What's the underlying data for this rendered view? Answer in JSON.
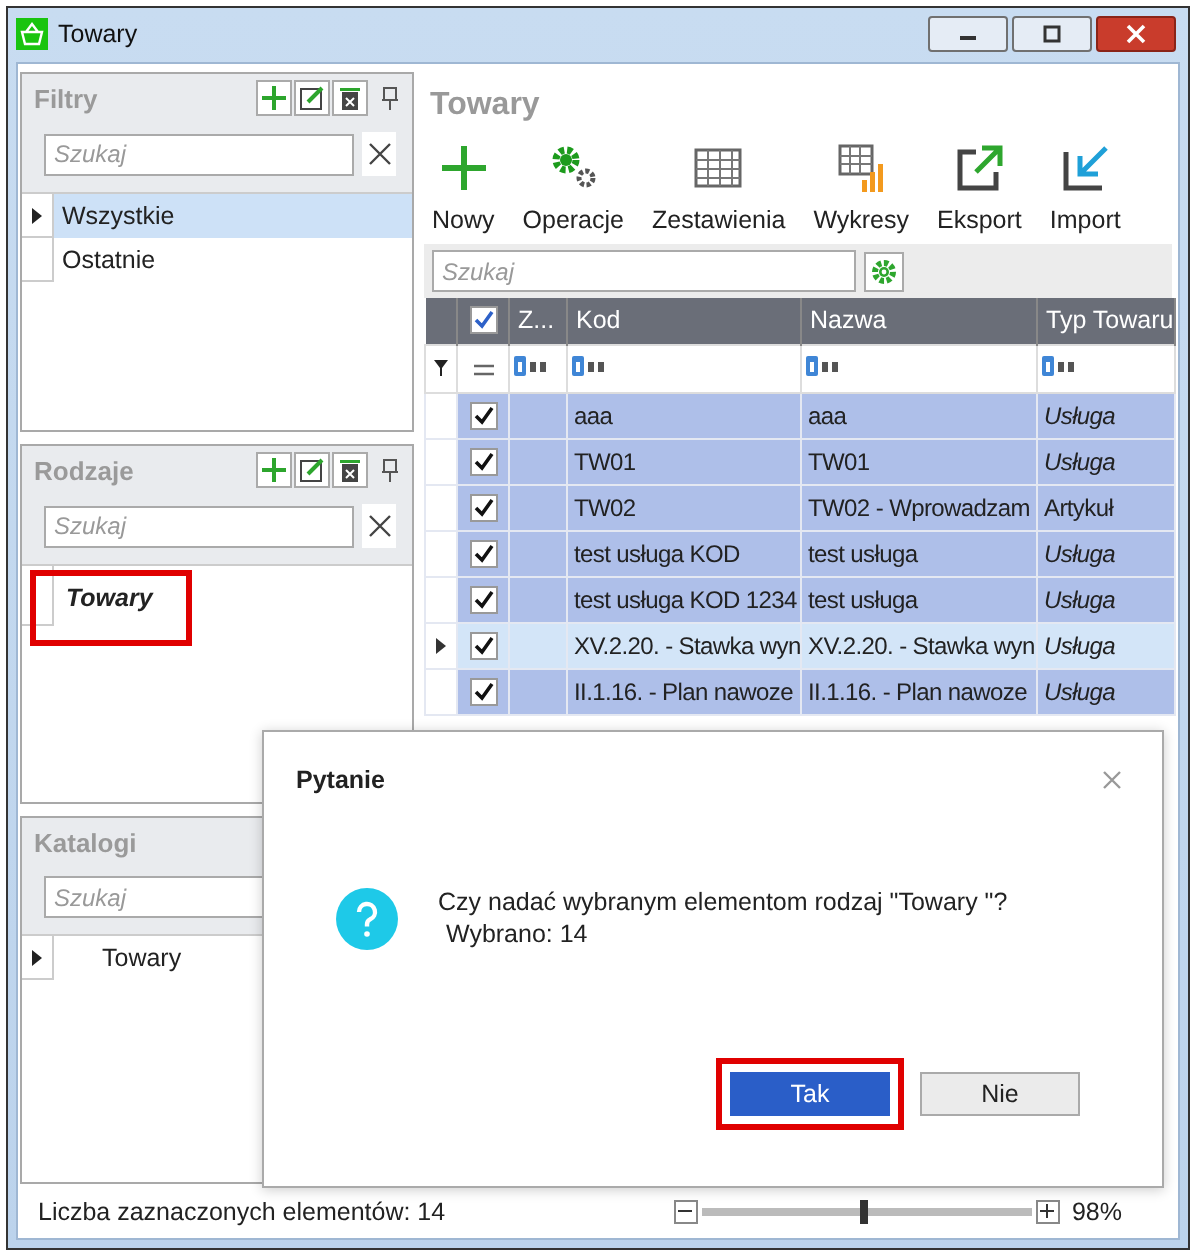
{
  "window": {
    "title": "Towary"
  },
  "panels": [
    {
      "title": "Filtry",
      "tools": true,
      "search": {
        "placeholder": "Szukaj",
        "clear_button": true
      },
      "items": [
        {
          "label": "Wszystkie",
          "selected": true,
          "expandable": true,
          "highlighted": false
        },
        {
          "label": "Ostatnie",
          "selected": false,
          "expandable": false,
          "highlighted": false
        }
      ]
    },
    {
      "title": "Rodzaje",
      "tools": true,
      "search": {
        "placeholder": "Szukaj",
        "clear_button": true
      },
      "items": [
        {
          "label": "Towary",
          "selected": false,
          "expandable": false,
          "highlighted": true
        }
      ]
    },
    {
      "title": "Katalogi",
      "tools": false,
      "search": {
        "placeholder": "Szukaj",
        "clear_button": false
      },
      "items": [
        {
          "label": "Towary",
          "selected": false,
          "expandable": true,
          "highlighted": false
        }
      ]
    }
  ],
  "heading": "Towary",
  "toolbar": [
    {
      "label": "Nowy",
      "kind": "plus"
    },
    {
      "label": "Operacje",
      "kind": "gears"
    },
    {
      "label": "Zestawienia",
      "kind": "table"
    },
    {
      "label": "Wykresy",
      "kind": "chart"
    },
    {
      "label": "Eksport",
      "kind": "export"
    },
    {
      "label": "Import",
      "kind": "import"
    }
  ],
  "grid_search": {
    "placeholder": "Szukaj"
  },
  "grid": {
    "all_checked": true,
    "columns": [
      "Z...",
      "Kod",
      "Nazwa",
      "Typ Towaru"
    ],
    "rows": [
      {
        "checked": true,
        "selected": true,
        "current": false,
        "kod": "aaa",
        "nazwa": "aaa",
        "typ": "Usługa",
        "typ_italic": true
      },
      {
        "checked": true,
        "selected": true,
        "current": false,
        "kod": "TW01",
        "nazwa": "TW01",
        "typ": "Usługa",
        "typ_italic": true
      },
      {
        "checked": true,
        "selected": true,
        "current": false,
        "kod": "TW02",
        "nazwa": "TW02 - Wprowadzam",
        "typ": "Artykuł",
        "typ_italic": false
      },
      {
        "checked": true,
        "selected": true,
        "current": false,
        "kod": "test usługa KOD",
        "nazwa": "test usługa",
        "typ": "Usługa",
        "typ_italic": true
      },
      {
        "checked": true,
        "selected": true,
        "current": false,
        "kod": "test usługa KOD 1234",
        "nazwa": "test usługa",
        "typ": "Usługa",
        "typ_italic": true
      },
      {
        "checked": true,
        "selected": false,
        "current": true,
        "kod": "XV.2.20. - Stawka wyn",
        "nazwa": "XV.2.20. - Stawka wyn",
        "typ": "Usługa",
        "typ_italic": true
      },
      {
        "checked": true,
        "selected": true,
        "current": false,
        "kod": "II.1.16. - Plan nawoze",
        "nazwa": "II.1.16. - Plan nawoze",
        "typ": "Usługa",
        "typ_italic": true
      }
    ]
  },
  "status_bar": {
    "text": "Liczba zaznaczonych elementów: 14",
    "zoom": {
      "level": 0.49,
      "reading": "98%"
    }
  },
  "dialog": {
    "title": "Pytanie",
    "message": [
      "Czy nadać wybranym elementom rodzaj \"Towary \"?",
      "Wybrano: 14"
    ],
    "buttons": [
      {
        "label": "Tak",
        "primary": true,
        "highlighted": true
      },
      {
        "label": "Nie",
        "primary": false,
        "highlighted": false
      }
    ]
  }
}
